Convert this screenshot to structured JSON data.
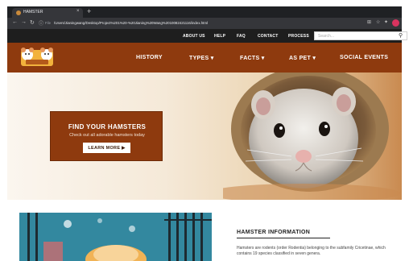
{
  "browser": {
    "tab_title": "HAMSTER",
    "tab_close": "×",
    "new_tab": "+",
    "url_label": "File",
    "url": "/Users/Jianingwang/Desktop/Project%201%20-%20Jianing%20Wang%2010082421116/index.html"
  },
  "topbar": {
    "links": [
      "ABOUT US",
      "HELP",
      "FAQ",
      "CONTACT",
      "PROCESS"
    ],
    "search_placeholder": "Search..."
  },
  "mainnav": {
    "items": [
      "HISTORY",
      "TYPES ▾",
      "FACTS ▾",
      "AS PET ▾",
      "SOCIAL EVENTS"
    ]
  },
  "hero": {
    "promo_title": "FIND YOUR HAMSTERS",
    "promo_sub": "Check out all adorable hamsters today",
    "button_label": "LEARN MORE ▶"
  },
  "info": {
    "title": "HAMSTER INFORMATION",
    "text": "Hamsters are rodents (order Rodentia) belonging to the subfamily Cricetinae, which contains 19 species classified in seven genera."
  },
  "colors": {
    "brand": "#8e3a0e",
    "topbar": "#1e1e1e"
  }
}
